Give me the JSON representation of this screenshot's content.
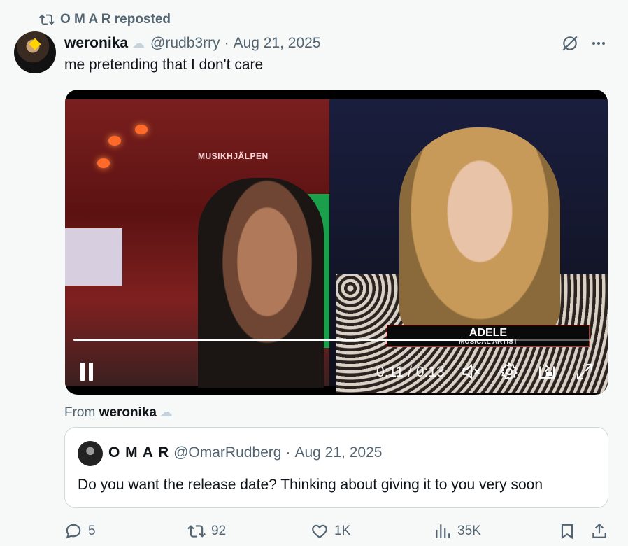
{
  "repost": {
    "label": "O M A R reposted"
  },
  "tweet": {
    "author_name": "weronika",
    "author_emoji": "☁",
    "handle": "@rudb3rry",
    "separator": "·",
    "date": "Aug 21, 2025",
    "text": "me pretending that I don't care"
  },
  "video": {
    "sign_text": "MUSIKHJÄLPEN",
    "lower_third_name": "ADELE",
    "lower_third_title": "MUSICAL ARTIST",
    "time": "0:11 / 0:13",
    "progress": 0.85,
    "icons": [
      "pause-icon",
      "muted-speaker-icon",
      "settings-gear-icon",
      "pip-icon",
      "fullscreen-icon"
    ]
  },
  "from": {
    "prefix": "From",
    "name": "weronika",
    "emoji": "☁"
  },
  "quote": {
    "author_name": "O M A R",
    "handle": "@OmarRudberg",
    "separator": "·",
    "date": "Aug 21, 2025",
    "text": "Do you want the release date? Thinking about giving it to you very soon"
  },
  "actions": {
    "replies": "5",
    "reposts": "92",
    "likes": "1K",
    "views": "35K"
  },
  "colors": {
    "secondary_text": "#536471",
    "primary_text": "#0f1419",
    "border": "#cfd9de"
  }
}
